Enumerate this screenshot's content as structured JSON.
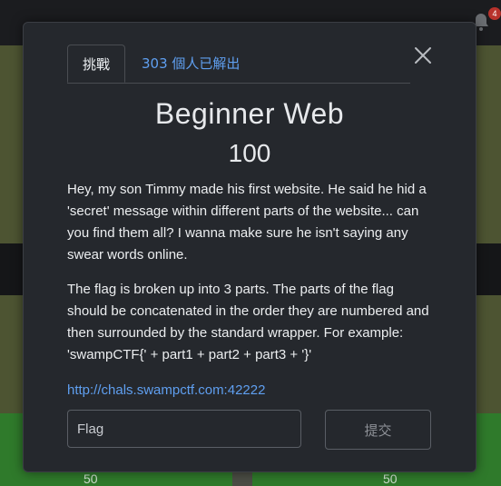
{
  "background": {
    "notification_count": "4",
    "points_left": "50",
    "points_right": "50"
  },
  "modal": {
    "tabs": {
      "challenge_label": "挑戰",
      "solves_label": "303 個人已解出"
    },
    "title": "Beginner Web",
    "value": "100",
    "description": [
      "Hey, my son Timmy made his first website. He said he hid a 'secret' message within different parts of the website... can you find them all? I wanna make sure he isn't saying any swear words online.",
      "The flag is broken up into 3 parts. The parts of the flag should be concatenated in the order they are numbered and then surrounded by the standard wrapper. For example: 'swampCTF{' + part1 + part2 + part3 + '}'"
    ],
    "link": "http://chals.swampctf.com:42222",
    "flag_input": {
      "value": "",
      "placeholder": "Flag"
    },
    "submit_label": "提交"
  }
}
